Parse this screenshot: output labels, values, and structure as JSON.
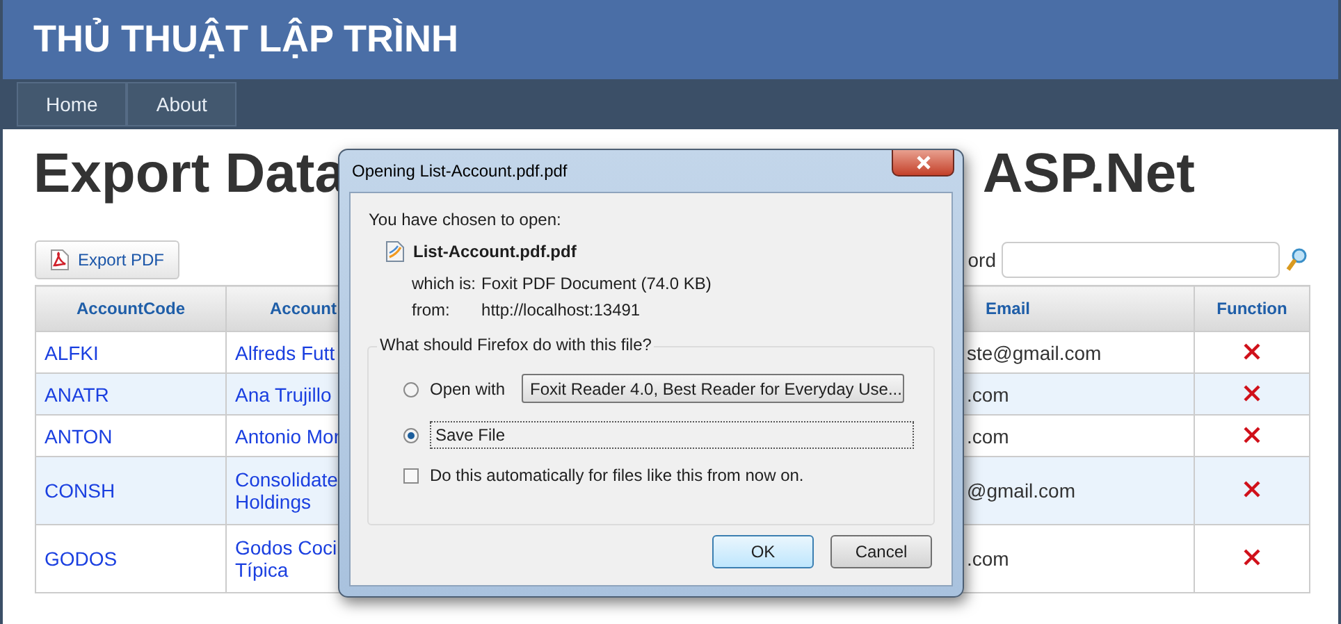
{
  "header": {
    "title": "THỦ THUẬT LẬP TRÌNH"
  },
  "nav": {
    "items": [
      {
        "label": "Home"
      },
      {
        "label": "About"
      }
    ]
  },
  "page_title": {
    "left": "Export Data",
    "right": "ASP.Net"
  },
  "export_button": {
    "label": "Export PDF"
  },
  "search": {
    "label": "ord"
  },
  "table": {
    "columns": [
      "AccountCode",
      "Account",
      "Email",
      "Function"
    ],
    "rows": [
      {
        "code": "ALFKI",
        "name": "Alfreds Futt",
        "email": "ste@gmail.com"
      },
      {
        "code": "ANATR",
        "name": "Ana Trujillo",
        "email": ".com"
      },
      {
        "code": "ANTON",
        "name": "Antonio Mor",
        "email": ".com"
      },
      {
        "code": "CONSH",
        "name": "Consolidate Holdings",
        "email": "@gmail.com"
      },
      {
        "code": "GODOS",
        "name": "Godos Coci Típica",
        "email": ".com"
      }
    ]
  },
  "dialog": {
    "title": "Opening List-Account.pdf.pdf",
    "intro": "You have chosen to open:",
    "filename": "List-Account.pdf.pdf",
    "details": [
      {
        "label": "which is:",
        "value": "Foxit PDF Document (74.0 KB)"
      },
      {
        "label": "from:",
        "value": "http://localhost:13491"
      }
    ],
    "group_label": "What should Firefox do with this file?",
    "options": [
      {
        "label": "Open with",
        "selected": false,
        "kind": "dropdown",
        "dropdown": "Foxit Reader 4.0, Best Reader for Everyday Use..."
      },
      {
        "label": "Save File",
        "selected": true,
        "kind": "plain"
      }
    ],
    "auto_checkbox": {
      "label": "Do this automatically for files like this from now on.",
      "checked": false
    },
    "buttons": [
      {
        "label": "OK",
        "default": true
      },
      {
        "label": "Cancel",
        "default": false
      }
    ]
  }
}
